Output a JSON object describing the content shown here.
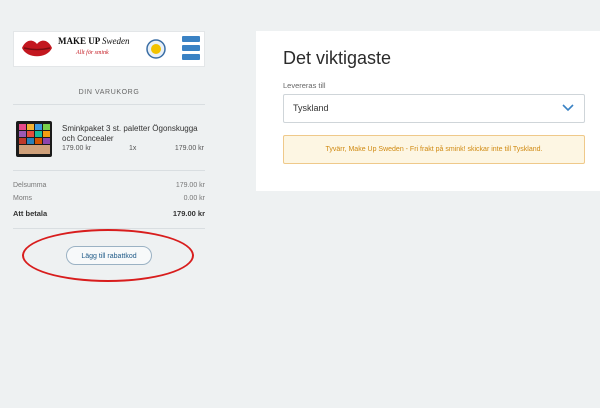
{
  "logo": {
    "brand_make": "MAKE UP",
    "brand_sweden": "Sweden",
    "slogan": "Allt för smink"
  },
  "cart": {
    "title": "DIN VARUKORG",
    "item": {
      "name": "Sminkpaket 3 st. paletter Ögonskugga och Concealer",
      "unit_price": "179.00 kr",
      "quantity": "1x",
      "total": "179.00 kr"
    },
    "summary": {
      "subtotal_label": "Delsumma",
      "subtotal_value": "179.00 kr",
      "vat_label": "Moms",
      "vat_value": "0.00 kr",
      "pay_label": "Att betala",
      "pay_value": "179.00 kr"
    },
    "discount_button": "Lägg till rabattkod"
  },
  "checkout": {
    "heading": "Det viktigaste",
    "ship_to_label": "Levereras till",
    "ship_to_value": "Tyskland",
    "warning": "Tyvärr, Make Up Sweden - Fri frakt på smink! skickar inte till Tyskland."
  },
  "colors": {
    "accent": "#1f5a88",
    "warning_text": "#d08a12",
    "annotation": "#d81d1d"
  }
}
